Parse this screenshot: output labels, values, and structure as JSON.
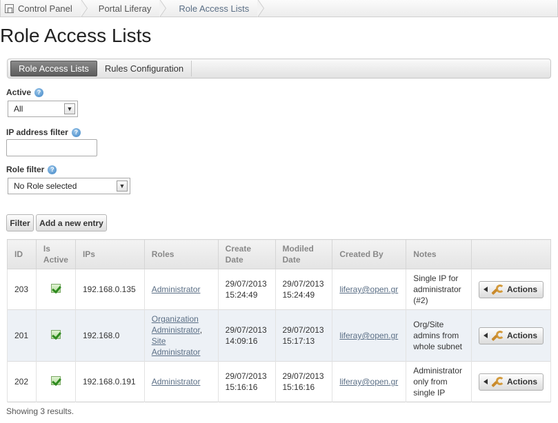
{
  "breadcrumb": {
    "items": [
      "Control Panel",
      "Portal Liferay",
      "Role Access Lists"
    ]
  },
  "page": {
    "title": "Role Access Lists"
  },
  "tabs": [
    {
      "label": "Role Access Lists",
      "active": true
    },
    {
      "label": "Rules Configuration",
      "active": false
    }
  ],
  "filters": {
    "active": {
      "label": "Active",
      "value": "All"
    },
    "ip": {
      "label": "IP address filter",
      "value": ""
    },
    "role": {
      "label": "Role filter",
      "value": "No Role selected"
    }
  },
  "buttons": {
    "filter": "Filter",
    "add": "Add a new entry"
  },
  "table": {
    "headers": [
      "ID",
      "Is Active",
      "IPs",
      "Roles",
      "Create Date",
      "Modiled Date",
      "Created By",
      "Notes",
      ""
    ],
    "rows": [
      {
        "id": "203",
        "active": true,
        "ips": "192.168.0.135",
        "roles": [
          "Administrator"
        ],
        "created": "29/07/2013 15:24:49",
        "modified": "29/07/2013 15:24:49",
        "created_by": "liferay@open.gr",
        "notes": "Single IP for administrator (#2)",
        "action": "Actions"
      },
      {
        "id": "201",
        "active": true,
        "ips": "192.168.0",
        "roles": [
          "Organization Administrator",
          "Site Administrator"
        ],
        "created": "29/07/2013 14:09:16",
        "modified": "29/07/2013 15:17:13",
        "created_by": "liferay@open.gr",
        "notes": "Org/Site admins from whole subnet",
        "action": "Actions"
      },
      {
        "id": "202",
        "active": true,
        "ips": "192.168.0.191",
        "roles": [
          "Administrator"
        ],
        "created": "29/07/2013 15:16:16",
        "modified": "29/07/2013 15:16:16",
        "created_by": "liferay@open.gr",
        "notes": "Administrator only from single IP",
        "action": "Actions"
      }
    ]
  },
  "footer": {
    "status": "Showing 3 results."
  },
  "icons": {
    "home": "control-panel-icon",
    "help": "help-icon",
    "check": "check-icon",
    "wrench": "wrench-icon",
    "menu_arrow": "triangle-left-icon"
  },
  "colors": {
    "link": "#5a6e85",
    "tab_active": "#5c5c5c",
    "row_alt": "#edf1f6",
    "help": "#3f85c6",
    "check": "#2e8b1f"
  }
}
